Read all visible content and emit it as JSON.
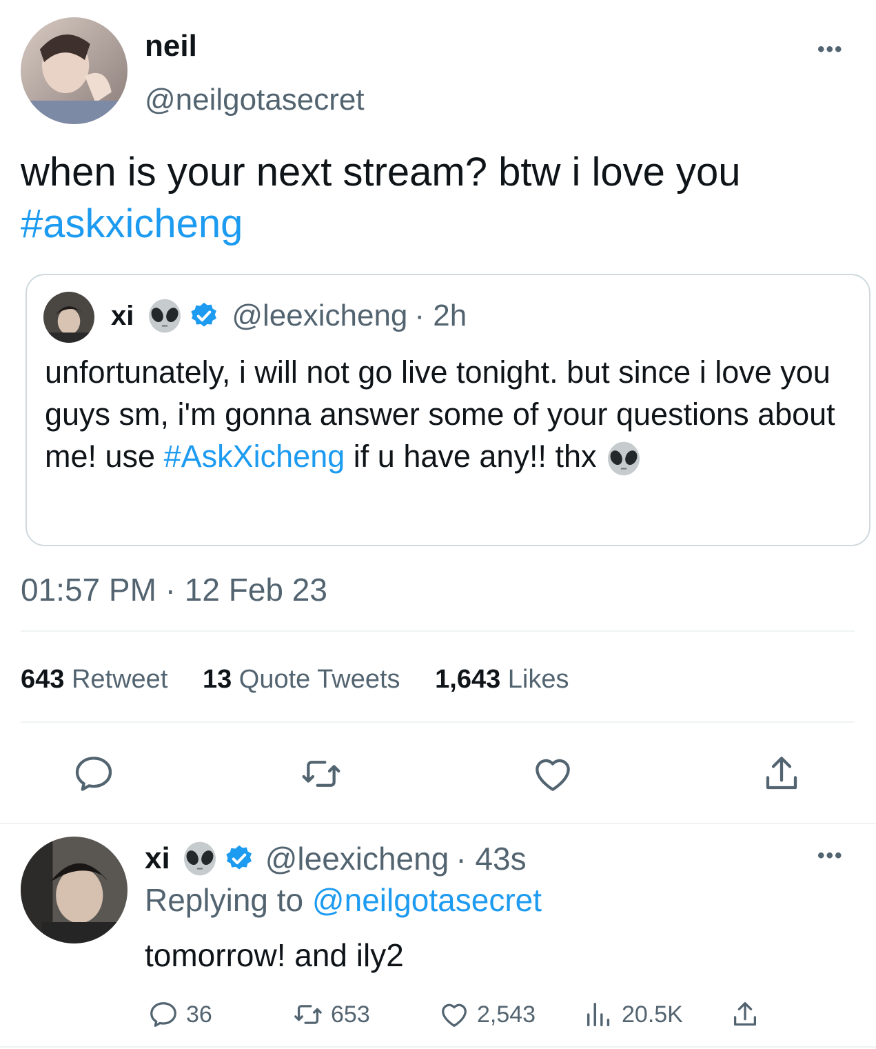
{
  "main_tweet": {
    "author_name": "neil",
    "author_handle": "@neilgotasecret",
    "more_label": "•••",
    "text": "when is your next stream? btw i love you",
    "hashtag": "#askxicheng",
    "timestamp": "01:57 PM · 12 Feb 23",
    "stats": {
      "retweets_count": "643",
      "retweets_label": "Retweet",
      "quotes_count": "13",
      "quotes_label": "Quote Tweets",
      "likes_count": "1,643",
      "likes_label": "Likes"
    }
  },
  "quoted_tweet": {
    "author_name": "xi",
    "author_handle": "@leexicheng",
    "age": "· 2h",
    "text_part1": "unfortunately, i will not go live tonight. but since i love you guys sm, i'm gonna answer some of your questions about me! use",
    "hashtag": "#AskXicheng",
    "text_part2": "if u have any!! thx"
  },
  "reply": {
    "author_name": "xi",
    "author_handle": "@leexicheng",
    "age": "· 43s",
    "more_label": "•••",
    "replying_prefix": "Replying to",
    "replying_handle": "@neilgotasecret",
    "text": "tomorrow! and ily2",
    "actions": {
      "replies": "36",
      "retweets": "653",
      "likes": "2,543",
      "views": "20.5K"
    }
  },
  "colors": {
    "accent": "#1d9bf0",
    "secondary_text": "#536471",
    "border": "#cfd9de"
  },
  "icons": [
    "reply-icon",
    "retweet-icon",
    "like-icon",
    "share-icon",
    "views-icon",
    "verified-badge-icon",
    "alien-emoji"
  ]
}
